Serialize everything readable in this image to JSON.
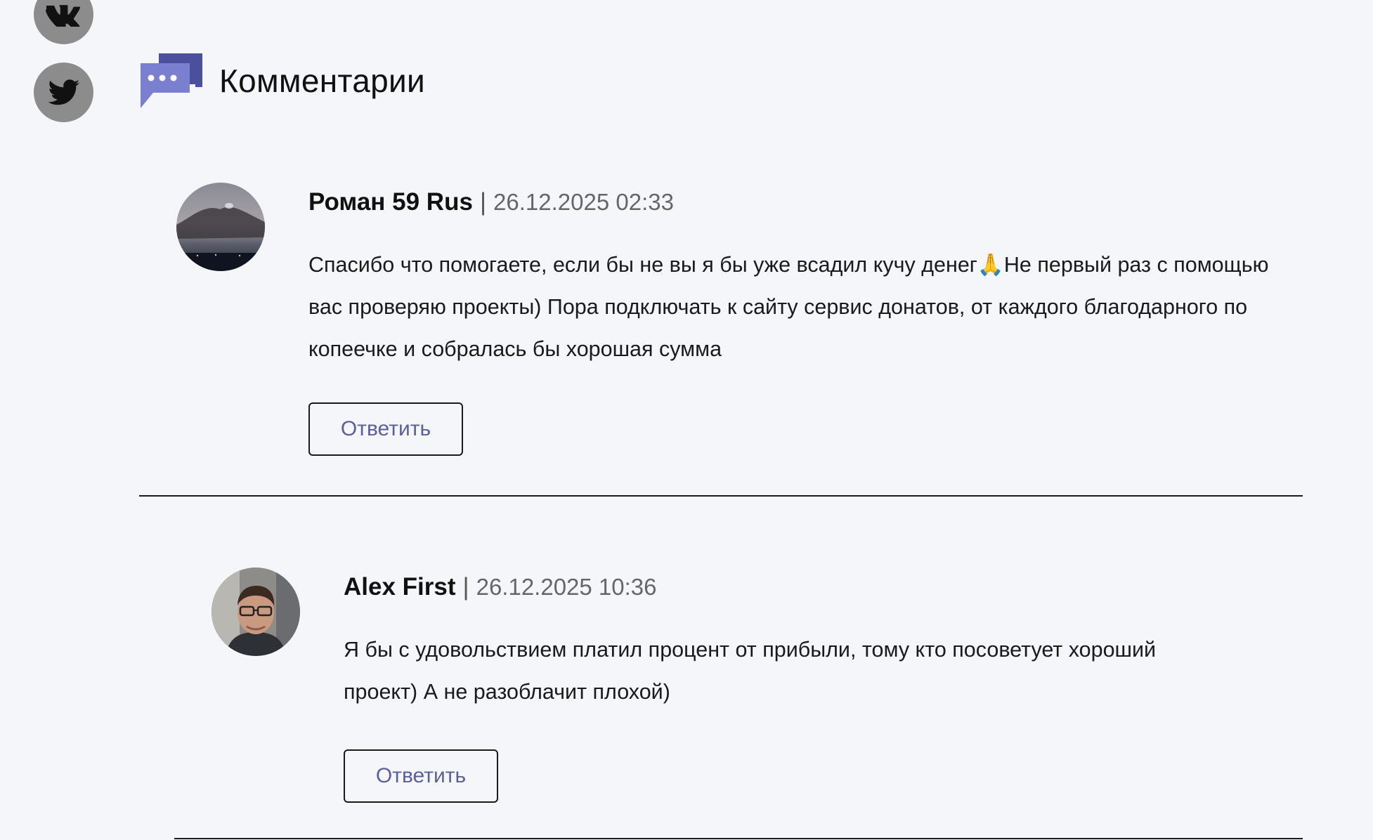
{
  "social": {
    "vk": {
      "icon": "vk-icon"
    },
    "twitter": {
      "icon": "twitter-icon"
    }
  },
  "comments_section": {
    "title": "Комментарии",
    "icon": "chat-bubbles-icon",
    "accent_color": "#5b5fb0"
  },
  "comments": [
    {
      "author": "Роман 59 Rus",
      "separator": "|",
      "date": "26.12.2025 02:33",
      "text": "Спасибо что помогаете, если бы не вы я бы уже всадил кучу денег🙏Не первый раз с помощью вас проверяю проекты) Пора подключать к сайту сервис донатов, от каждого благодарного по копеечке и собралась бы хорошая сумма",
      "reply_label": "Ответить"
    },
    {
      "author": "Alex First",
      "separator": "|",
      "date": "26.12.2025 10:36",
      "text": "Я бы с удовольствием платил процент от прибыли, тому кто посоветует хороший проект) А не разоблачит плохой)",
      "reply_label": "Ответить"
    }
  ],
  "colors": {
    "background": "#f5f6fa",
    "social_button": "#8c8c8c",
    "reply_text": "#5b5f9e"
  }
}
